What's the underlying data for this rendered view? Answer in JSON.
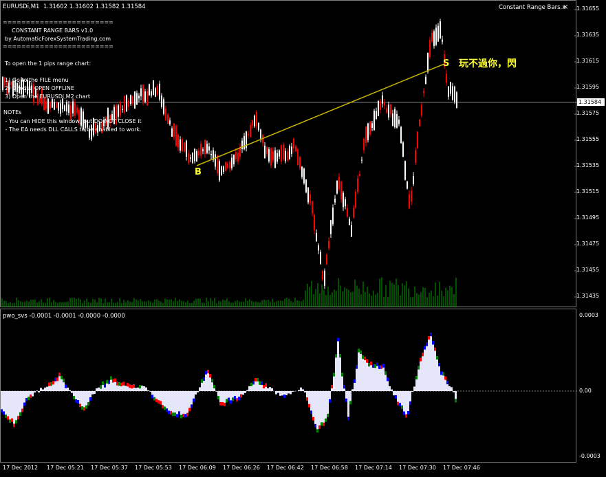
{
  "chart_header": "EURUSDi,M1  1.31602 1.31602 1.31582 1.31584",
  "ea_name": "Constant Range Bars.x",
  "close_icon": "close-icon",
  "info": {
    "sep1": "========================",
    "title": "CONSTANT RANGE BARS v1.0",
    "by": "by AutomaticForexSystemTrading.com",
    "sep2": "========================",
    "open_line": "To open the 1 pips range chart:",
    "step1": "1) Go to the FILE menu",
    "step2": "2) Choose OPEN OFFLINE",
    "step3": "3) Open the EURUSDi,M2 chart",
    "notes_title": "NOTEs",
    "note1": " - You can HIDE this window, but DO NOT CLOSE it",
    "note2": " - The EA needs DLL CALLS to be enabled to work."
  },
  "annotation_text": "玩不過你，閃",
  "marker_buy": "B",
  "marker_sell": "S",
  "current_price": "1.31584",
  "price_axis": [
    "1.31655",
    "1.31635",
    "1.31615",
    "1.31595",
    "1.31575",
    "1.31555",
    "1.31535",
    "1.31515",
    "1.31495",
    "1.31475",
    "1.31455",
    "1.31435"
  ],
  "indicator_header": "pwo_svs -0.0001 -0.0001 -0.0000 -0.0000",
  "indicator_axis": [
    "0.0003",
    "0.00",
    "-0.0003"
  ],
  "time_axis": [
    "17 Dec 2012",
    "17 Dec 05:21",
    "17 Dec 05:37",
    "17 Dec 05:53",
    "17 Dec 06:09",
    "17 Dec 06:26",
    "17 Dec 06:42",
    "17 Dec 06:58",
    "17 Dec 07:14",
    "17 Dec 07:30",
    "17 Dec 07:46"
  ],
  "colors": {
    "bull": "#ff0000",
    "bear": "#ffffff",
    "volume": "#00a000",
    "trend": "#c8b400",
    "ind_fill": "#e6e6fa",
    "ind_blue": "#0000ff",
    "ind_green": "#008000",
    "ind_red": "#ff0000",
    "marker": "#ffff33"
  }
}
